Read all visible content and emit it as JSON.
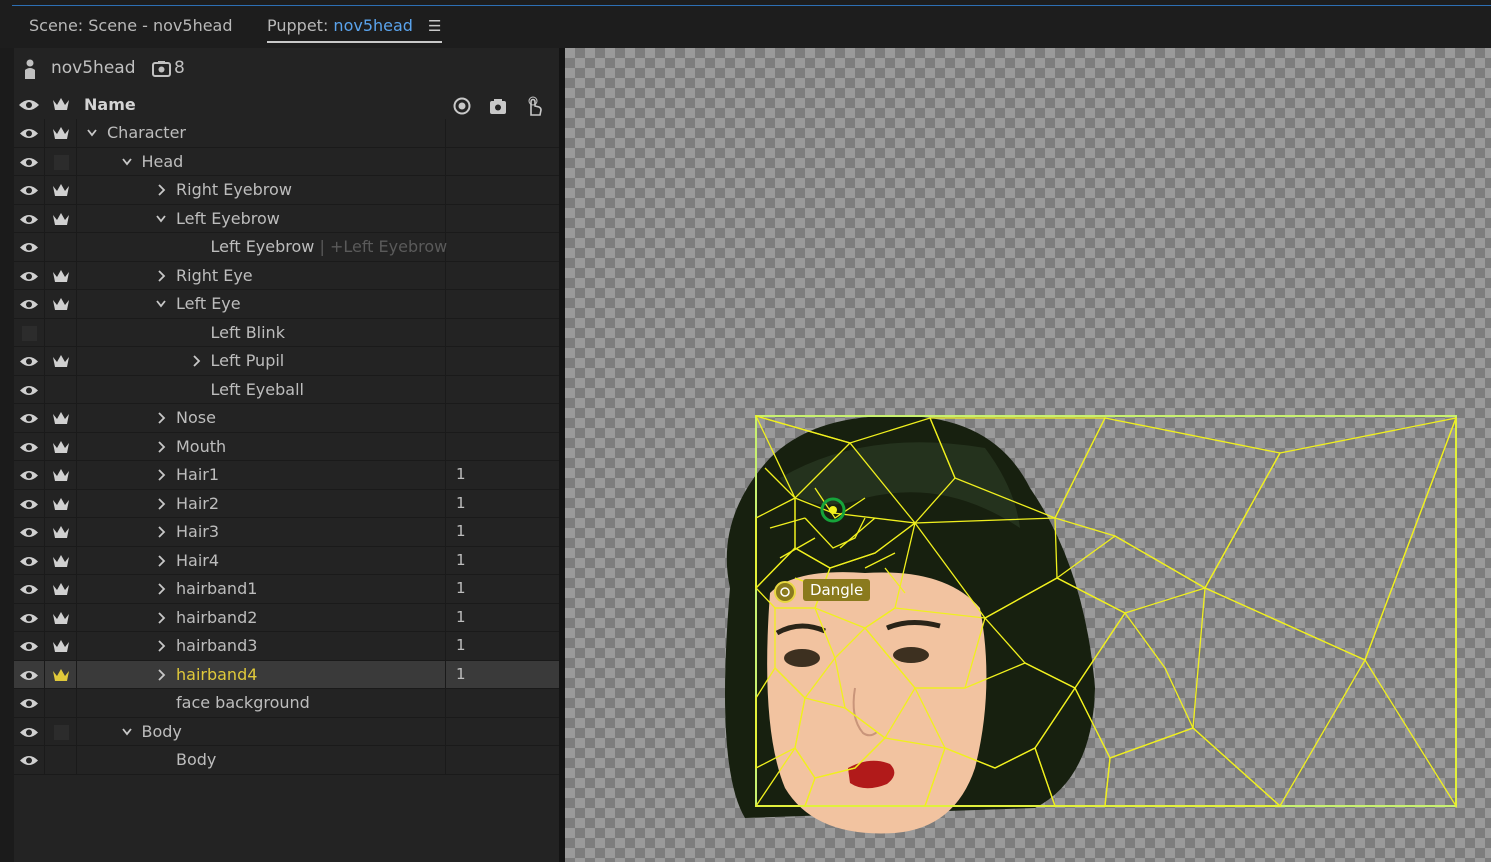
{
  "tabs": {
    "scene": "Scene: Scene - nov5head",
    "puppet_prefix": "Puppet:",
    "puppet_name": "nov5head",
    "menu_icon": "hamburger-menu-icon"
  },
  "header": {
    "puppet_name": "nov5head",
    "camera_count": "8"
  },
  "columns": {
    "name": "Name"
  },
  "rows": [
    {
      "label": "Character",
      "num": ""
    },
    {
      "label": "Head",
      "num": ""
    },
    {
      "label": "Right Eyebrow",
      "num": ""
    },
    {
      "label": "Left Eyebrow",
      "num": ""
    },
    {
      "label": "Left Eyebrow",
      "tag": " | +Left Eyebrow",
      "num": ""
    },
    {
      "label": "Right Eye",
      "num": ""
    },
    {
      "label": "Left Eye",
      "num": ""
    },
    {
      "label": "Left Blink",
      "num": ""
    },
    {
      "label": "Left Pupil",
      "num": ""
    },
    {
      "label": "Left Eyeball",
      "num": ""
    },
    {
      "label": "Nose",
      "num": ""
    },
    {
      "label": "Mouth",
      "num": ""
    },
    {
      "label": "Hair1",
      "num": "1"
    },
    {
      "label": "Hair2",
      "num": "1"
    },
    {
      "label": "Hair3",
      "num": "1"
    },
    {
      "label": "Hair4",
      "num": "1"
    },
    {
      "label": "hairband1",
      "num": "1"
    },
    {
      "label": "hairband2",
      "num": "1"
    },
    {
      "label": "hairband3",
      "num": "1"
    },
    {
      "label": "hairband4",
      "num": "1"
    },
    {
      "label": "face background",
      "num": ""
    },
    {
      "label": "Body",
      "num": ""
    },
    {
      "label": "Body",
      "num": ""
    }
  ],
  "canvas": {
    "handle_label": "Dangle",
    "mesh_color": "#f0f01e",
    "accent_color": "#5aa3ec"
  }
}
